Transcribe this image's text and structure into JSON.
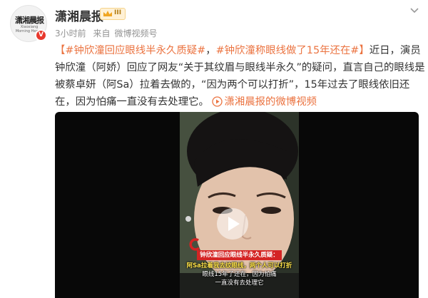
{
  "account": {
    "name": "潇湘晨报",
    "logo_text_main": "潇湘晨报",
    "logo_text_sub": "Xiaoxiang Morning Herald",
    "vip_level": "III",
    "verified_badge": "V"
  },
  "meta": {
    "time": "3小时前",
    "source_prefix": "来自",
    "source": "微博视频号"
  },
  "post": {
    "tag1": "【#钟欣潼回应眼线半永久质疑#",
    "tag2": "#钟欣潼称眼线做了15年还在#",
    "bracket_close": "】",
    "body_a": "近日，演员钟欣潼（阿娇）回应了网友“关于其纹眉与眼线半永久”的疑问，直言自己的眼线是被蔡卓妍（阿Sa）拉着去做的，“因为两个可以打折”，15年过去了眼线依旧还在，因为怕痛一直没有去处理它。",
    "separator": "，",
    "video_link": "潇湘晨报的微博视频"
  },
  "video": {
    "caption_title": "钟欣潼回应眼线半永久质疑：",
    "caption_line2": "阿Sa拉着我去纹眼线，两个人可以打折",
    "caption_line3": "眼线15年了还在，因为怕痛",
    "caption_line4": "一直没有去处理它"
  },
  "colors": {
    "accent": "#eb7340",
    "meta_gray": "#939393",
    "badge_red": "#e8382d",
    "caption_red": "#d42424"
  },
  "icons": [
    "chevron-down-icon",
    "crown-icon",
    "play-icon",
    "video-link-icon"
  ]
}
